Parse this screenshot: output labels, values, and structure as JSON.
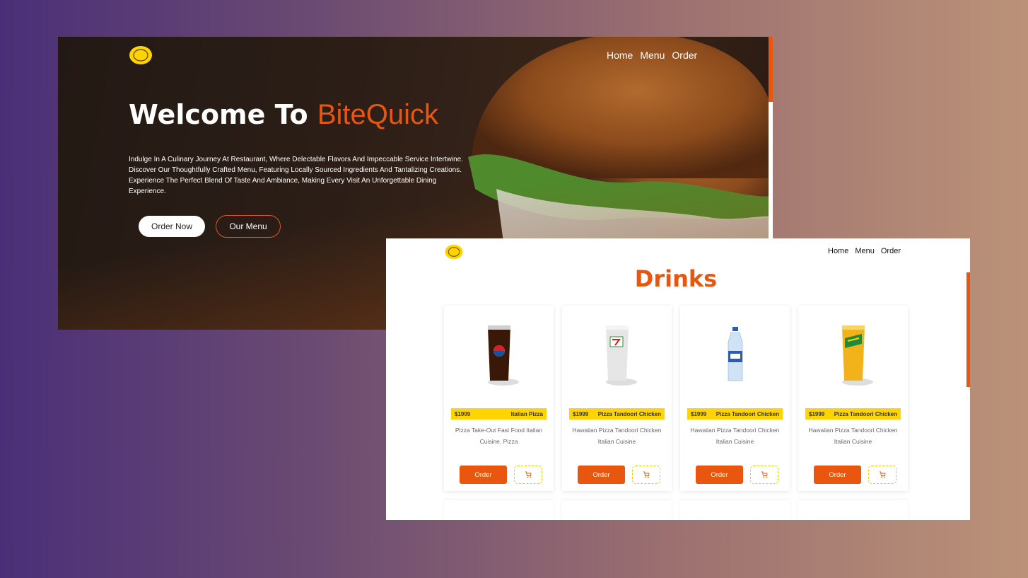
{
  "colors": {
    "accent": "#e8560f",
    "logo": "#ffd400",
    "tag": "#ffd400"
  },
  "hero": {
    "nav": [
      "Home",
      "Menu",
      "Order"
    ],
    "title_prefix": "Welcome To ",
    "title_brand": "BiteQuick",
    "description": "Indulge In A Culinary Journey At Restaurant, Where Delectable Flavors And Impeccable Service Intertwine. Discover Our Thoughtfully Crafted Menu, Featuring Locally Sourced Ingredients And Tantalizing Creations. Experience The Perfect Blend Of Taste And Ambiance, Making Every Visit An Unforgettable Dining Experience.",
    "primary_button": "Order Now",
    "secondary_button": "Our Menu"
  },
  "menu_page": {
    "nav": [
      "Home",
      "Menu",
      "Order"
    ],
    "section_title": "Drinks",
    "cards": [
      {
        "drink": "pepsi-glass",
        "price": "$1999",
        "name": "Italian Pizza",
        "desc": "Pizza Take-Out Fast Food Italian Cuisine, Pizza",
        "order": "Order",
        "cart_icon": "cart-icon"
      },
      {
        "drink": "7up-glass",
        "price": "$1999",
        "name": "Pizza Tandoori Chicken",
        "desc": "Hawaiian Pizza Tandoori Chicken Italian Cuisine",
        "order": "Order",
        "cart_icon": "cart-icon"
      },
      {
        "drink": "water-bottle",
        "price": "$1999",
        "name": "Pizza Tandoori Chicken",
        "desc": "Hawaiian Pizza Tandoori Chicken Italian Cuisine",
        "order": "Order",
        "cart_icon": "cart-icon"
      },
      {
        "drink": "mirinda-glass",
        "price": "$1999",
        "name": "Pizza Tandoori Chicken",
        "desc": "Hawaiian Pizza Tandoori Chicken Italian Cuisine",
        "order": "Order",
        "cart_icon": "cart-icon"
      }
    ]
  }
}
